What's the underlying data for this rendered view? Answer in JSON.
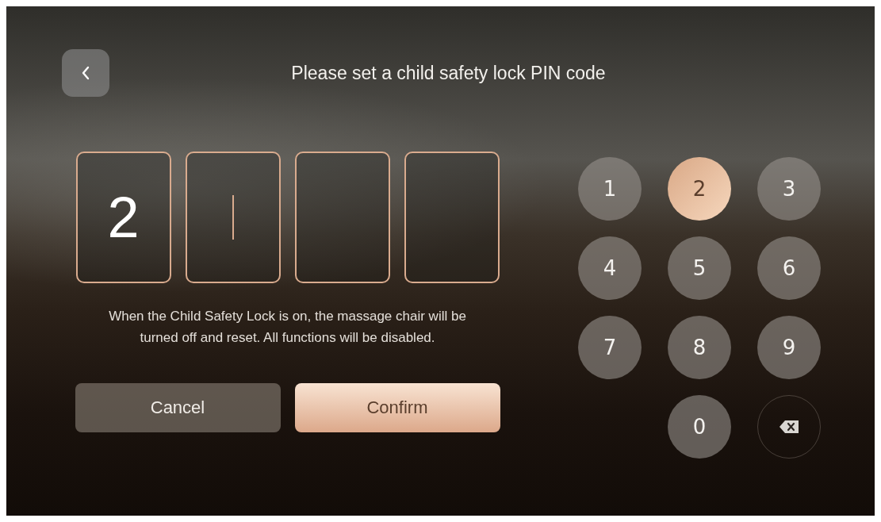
{
  "title": "Please set a child safety lock PIN code",
  "pin_boxes": [
    {
      "value": "2",
      "cursor": false
    },
    {
      "cursor": true
    },
    {
      "cursor": false
    },
    {
      "cursor": false
    }
  ],
  "notice": "When the Child Safety Lock is on, the massage chair will be turned off and reset. All functions will be disabled.",
  "buttons": [
    {
      "label": "Cancel",
      "kind": "secondary"
    },
    {
      "label": "Confirm",
      "kind": "primary"
    }
  ],
  "keypad": [
    {
      "kind": "digit",
      "label": "1",
      "selected": false
    },
    {
      "kind": "digit",
      "label": "2",
      "selected": true
    },
    {
      "kind": "digit",
      "label": "3",
      "selected": false
    },
    {
      "kind": "digit",
      "label": "4",
      "selected": false
    },
    {
      "kind": "digit",
      "label": "5",
      "selected": false
    },
    {
      "kind": "digit",
      "label": "6",
      "selected": false
    },
    {
      "kind": "digit",
      "label": "7",
      "selected": false
    },
    {
      "kind": "digit",
      "label": "8",
      "selected": false
    },
    {
      "kind": "digit",
      "label": "9",
      "selected": false
    },
    {
      "kind": "digit",
      "label": "0",
      "selected": false
    },
    {
      "kind": "backspace",
      "selected": false
    }
  ]
}
